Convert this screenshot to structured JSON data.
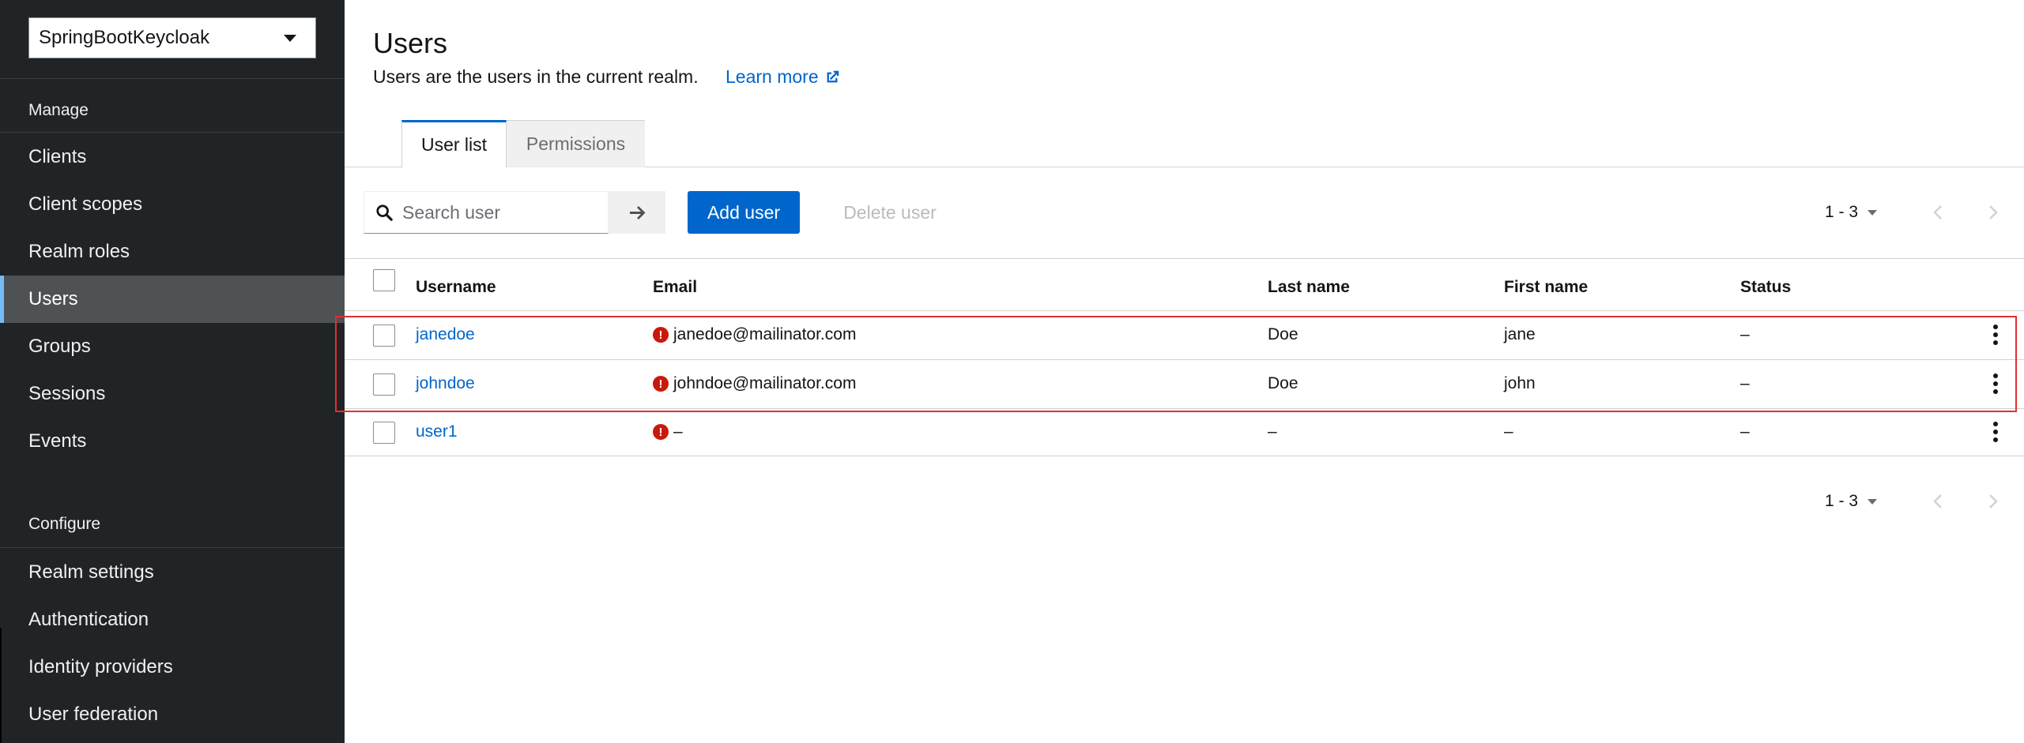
{
  "sidebar": {
    "realm": "SpringBootKeycloak",
    "manage_label": "Manage",
    "configure_label": "Configure",
    "manage_items": [
      {
        "label": "Clients"
      },
      {
        "label": "Client scopes"
      },
      {
        "label": "Realm roles"
      },
      {
        "label": "Users",
        "active": true
      },
      {
        "label": "Groups"
      },
      {
        "label": "Sessions"
      },
      {
        "label": "Events"
      }
    ],
    "configure_items": [
      {
        "label": "Realm settings"
      },
      {
        "label": "Authentication"
      },
      {
        "label": "Identity providers"
      },
      {
        "label": "User federation"
      }
    ]
  },
  "header": {
    "title": "Users",
    "description": "Users are the users in the current realm.",
    "learn_more": "Learn more"
  },
  "tabs": [
    {
      "label": "User list",
      "active": true
    },
    {
      "label": "Permissions",
      "active": false
    }
  ],
  "toolbar": {
    "search_placeholder": "Search user",
    "add_label": "Add user",
    "delete_label": "Delete user",
    "pagination": "1 - 3"
  },
  "table": {
    "columns": [
      "Username",
      "Email",
      "Last name",
      "First name",
      "Status"
    ],
    "rows": [
      {
        "username": "janedoe",
        "email": "janedoe@mailinator.com",
        "last_name": "Doe",
        "first_name": "jane",
        "status": "–"
      },
      {
        "username": "johndoe",
        "email": "johndoe@mailinator.com",
        "last_name": "Doe",
        "first_name": "john",
        "status": "–"
      },
      {
        "username": "user1",
        "email": "–",
        "last_name": "–",
        "first_name": "–",
        "status": "–"
      }
    ]
  },
  "colors": {
    "sidebar_bg": "#212427",
    "primary": "#0066cc",
    "active_item_bg": "#4f5255",
    "warning": "#c9190b",
    "highlight_border": "#e03030"
  }
}
